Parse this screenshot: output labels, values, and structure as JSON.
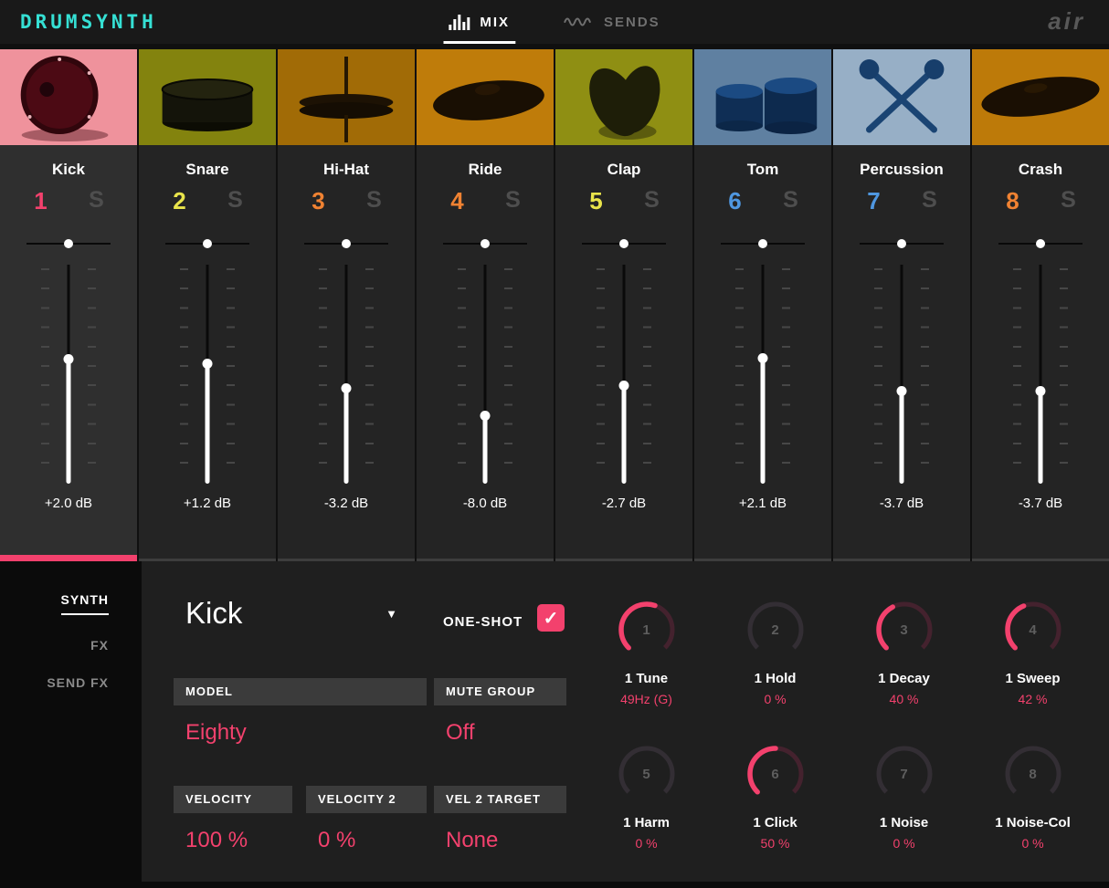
{
  "theme": {
    "accent": "#f3416d",
    "logo_color": "#35e0d4"
  },
  "topbar": {
    "logo": "DRUMSYNTH",
    "brand": "air",
    "tabs": [
      {
        "label": "MIX",
        "active": true
      },
      {
        "label": "SENDS",
        "active": false
      }
    ]
  },
  "channels": [
    {
      "name": "Kick",
      "number": "1",
      "number_color": "#f3416d",
      "solo": "S",
      "db": "+2.0 dB",
      "db_value": 2.0,
      "selected": true,
      "thumb": "kick",
      "thumb_bg": "#ef929c"
    },
    {
      "name": "Snare",
      "number": "2",
      "number_color": "#e9e44b",
      "solo": "S",
      "db": "+1.2 dB",
      "db_value": 1.2,
      "selected": false,
      "thumb": "snare",
      "thumb_bg": "#83830e"
    },
    {
      "name": "Hi-Hat",
      "number": "3",
      "number_color": "#f08232",
      "solo": "S",
      "db": "-3.2 dB",
      "db_value": -3.2,
      "selected": false,
      "thumb": "hihat",
      "thumb_bg": "#a16b06"
    },
    {
      "name": "Ride",
      "number": "4",
      "number_color": "#f08232",
      "solo": "S",
      "db": "-8.0 dB",
      "db_value": -8.0,
      "selected": false,
      "thumb": "ride",
      "thumb_bg": "#bf7c0a"
    },
    {
      "name": "Clap",
      "number": "5",
      "number_color": "#e9e44b",
      "solo": "S",
      "db": "-2.7 dB",
      "db_value": -2.7,
      "selected": false,
      "thumb": "clap",
      "thumb_bg": "#8f8f13"
    },
    {
      "name": "Tom",
      "number": "6",
      "number_color": "#4f97e0",
      "solo": "S",
      "db": "+2.1 dB",
      "db_value": 2.1,
      "selected": false,
      "thumb": "tom",
      "thumb_bg": "#5f80a1"
    },
    {
      "name": "Percussion",
      "number": "7",
      "number_color": "#4f97e0",
      "solo": "S",
      "db": "-3.7 dB",
      "db_value": -3.7,
      "selected": false,
      "thumb": "perc",
      "thumb_bg": "#97afc6"
    },
    {
      "name": "Crash",
      "number": "8",
      "number_color": "#f08232",
      "solo": "S",
      "db": "-3.7 dB",
      "db_value": -3.7,
      "selected": false,
      "thumb": "crash",
      "thumb_bg": "#bd7a09"
    }
  ],
  "sidebar": {
    "items": [
      {
        "label": "SYNTH",
        "active": true
      },
      {
        "label": "FX",
        "active": false
      },
      {
        "label": "SEND FX",
        "active": false
      }
    ]
  },
  "editor": {
    "pad_name": "Kick",
    "one_shot": {
      "label": "ONE-SHOT",
      "checked": true
    },
    "fields": {
      "model": {
        "label": "MODEL",
        "value": "Eighty"
      },
      "mute_group": {
        "label": "MUTE GROUP",
        "value": "Off"
      },
      "velocity": {
        "label": "VELOCITY",
        "value": "100 %"
      },
      "velocity2": {
        "label": "VELOCITY 2",
        "value": "0 %"
      },
      "vel2_target": {
        "label": "VEL 2 TARGET",
        "value": "None"
      }
    },
    "knobs": [
      {
        "num": "1",
        "label": "1 Tune",
        "value": "49Hz (G)",
        "fraction": 0.57,
        "lit": true
      },
      {
        "num": "2",
        "label": "1 Hold",
        "value": "0 %",
        "fraction": 0,
        "lit": false
      },
      {
        "num": "3",
        "label": "1 Decay",
        "value": "40 %",
        "fraction": 0.4,
        "lit": true
      },
      {
        "num": "4",
        "label": "1 Sweep",
        "value": "42 %",
        "fraction": 0.42,
        "lit": true
      },
      {
        "num": "5",
        "label": "1 Harm",
        "value": "0 %",
        "fraction": 0,
        "lit": false
      },
      {
        "num": "6",
        "label": "1 Click",
        "value": "50 %",
        "fraction": 0.5,
        "lit": true
      },
      {
        "num": "7",
        "label": "1 Noise",
        "value": "0 %",
        "fraction": 0,
        "lit": false
      },
      {
        "num": "8",
        "label": "1 Noise-Col",
        "value": "0 %",
        "fraction": 0,
        "lit": false
      }
    ]
  }
}
